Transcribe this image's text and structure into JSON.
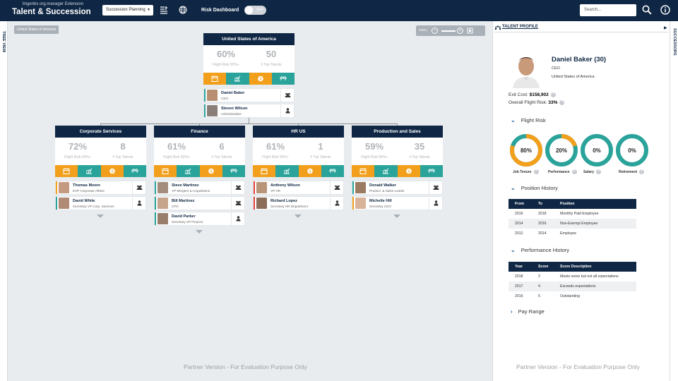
{
  "header": {
    "subtitle": "lingenbs org.manager Extension",
    "title": "Talent & Succession",
    "view_select": "Succession Planning",
    "risk_label": "Risk Dashboard",
    "risk_toggle": "OFF",
    "search_placeholder": "Search..."
  },
  "left_tab": "TREE VIEW",
  "right_tab": "SUCCESSORS",
  "breadcrumb": "United States of America",
  "zoom": {
    "level": "100%"
  },
  "root": {
    "title": "United States of America",
    "flight_risk": "60%",
    "flight_risk_label": "Flight Risk 50%+",
    "top_talents": "50",
    "top_talents_label": "# Top Talents",
    "people": [
      {
        "name": "Daniel Baker",
        "title": "CEO"
      },
      {
        "name": "Steven Wilson",
        "title": "Administrative"
      }
    ]
  },
  "departments": [
    {
      "title": "Corporate Services",
      "flight_risk": "72%",
      "flight_risk_label": "Flight Risk 50%+",
      "top_talents": "8",
      "top_talents_label": "# Top Talents",
      "people": [
        {
          "name": "Thomas Moore",
          "title": "EVP Corporate Affairs"
        },
        {
          "name": "David White",
          "title": "Secretary VP Corp. Services"
        }
      ]
    },
    {
      "title": "Finance",
      "flight_risk": "61%",
      "flight_risk_label": "Flight Risk 50%+",
      "top_talents": "6",
      "top_talents_label": "# Top Talents",
      "people": [
        {
          "name": "Steve Martinez",
          "title": "VP Mergers & Acquisitions"
        },
        {
          "name": "Bill Martinez",
          "title": "CFO"
        },
        {
          "name": "David Parker",
          "title": "Secretary VP Finance"
        }
      ]
    },
    {
      "title": "HR US",
      "flight_risk": "61%",
      "flight_risk_label": "Flight Risk 50%+",
      "top_talents": "1",
      "top_talents_label": "# Top Talents",
      "people": [
        {
          "name": "Anthony Wilson",
          "title": "VP HR"
        },
        {
          "name": "Richard Lopez",
          "title": "Secretary HR Department"
        }
      ]
    },
    {
      "title": "Production and Sales",
      "flight_risk": "59%",
      "flight_risk_label": "Flight Risk 50%+",
      "top_talents": "35",
      "top_talents_label": "# Top Talents",
      "people": [
        {
          "name": "Donald Walker",
          "title": "Product. & Sales Leader"
        },
        {
          "name": "Michelle Hill",
          "title": "Secretary CEO"
        }
      ]
    }
  ],
  "watermark": "Partner Version - For Evaluation Purpose Only",
  "profile": {
    "tab": "TALENT PROFILE",
    "name": "Daniel Baker (30)",
    "role": "CEO",
    "location": "United States of America",
    "exit_cost_label": "Exit Cost:",
    "exit_cost": "$158,902",
    "overall_risk_label": "Overall Flight Risk:",
    "overall_risk": "33%",
    "flight_risk_title": "Flight Risk",
    "donuts": [
      {
        "value": "80%",
        "pct": 80,
        "color": "#f29f1c",
        "label": "Job Tenure"
      },
      {
        "value": "20%",
        "pct": 20,
        "color": "#f29f1c",
        "label": "Performance"
      },
      {
        "value": "0%",
        "pct": 0,
        "color": "#2aa39a",
        "label": "Salary"
      },
      {
        "value": "0%",
        "pct": 0,
        "color": "#2aa39a",
        "label": "Retirement"
      }
    ],
    "position_history_title": "Position History",
    "position_headers": [
      "From",
      "To",
      "Position"
    ],
    "position_rows": [
      [
        "2016",
        "2018",
        "Monthly Paid Employee"
      ],
      [
        "2014",
        "2016",
        "Non-Exempt Employee"
      ],
      [
        "2012",
        "2014",
        "Employee"
      ]
    ],
    "performance_history_title": "Performance History",
    "performance_headers": [
      "Year",
      "Score",
      "Score Description"
    ],
    "performance_rows": [
      [
        "2018",
        "2",
        "Meets some but not all expectations"
      ],
      [
        "2017",
        "4",
        "Exceeds expectations"
      ],
      [
        "2016",
        "5",
        "Outstanding"
      ]
    ],
    "pay_range_title": "Pay Range"
  }
}
